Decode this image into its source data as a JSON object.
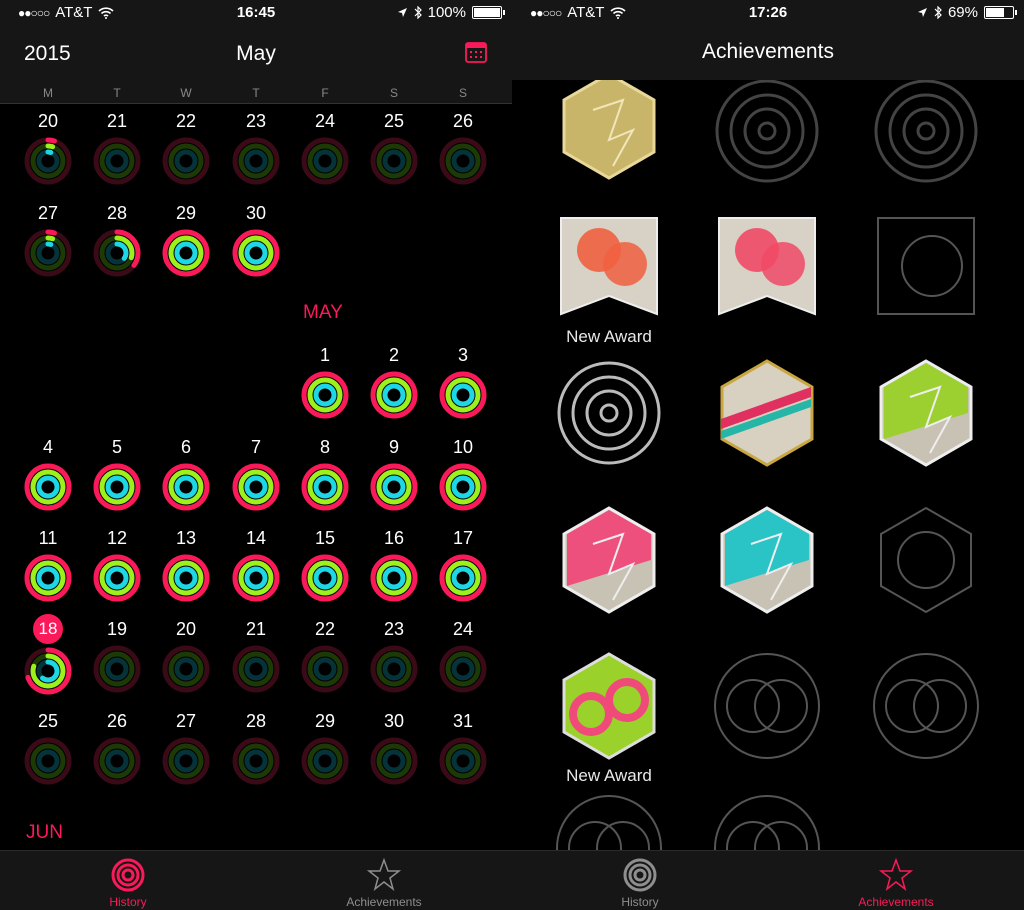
{
  "left": {
    "status": {
      "carrier_dots": "●●○○○",
      "carrier": "AT&T",
      "time": "16:45",
      "battery": "100%",
      "battery_level": 1.0
    },
    "nav": {
      "year": "2015",
      "month": "May"
    },
    "weekdays": [
      "M",
      "T",
      "W",
      "T",
      "F",
      "S",
      "S"
    ],
    "april_week1": [
      "20",
      "21",
      "22",
      "23",
      "24",
      "25",
      "26"
    ],
    "april_week2": [
      "27",
      "28",
      "29",
      "30"
    ],
    "may_label": "MAY",
    "may_week1": [
      "1",
      "2",
      "3"
    ],
    "may_week2": [
      "4",
      "5",
      "6",
      "7",
      "8",
      "9",
      "10"
    ],
    "may_week3": [
      "11",
      "12",
      "13",
      "14",
      "15",
      "16",
      "17"
    ],
    "may_week4": [
      "18",
      "19",
      "20",
      "21",
      "22",
      "23",
      "24"
    ],
    "may_week5": [
      "25",
      "26",
      "27",
      "28",
      "29",
      "30",
      "31"
    ],
    "jun_label": "JUN",
    "tabs": {
      "history": "History",
      "achievements": "Achievements"
    }
  },
  "right": {
    "status": {
      "carrier_dots": "●●○○○",
      "carrier": "AT&T",
      "time": "17:26",
      "battery": "69%",
      "battery_level": 0.69
    },
    "nav": {
      "title": "Achievements"
    },
    "labels": {
      "award1": "New Award",
      "award2": "New Award"
    },
    "tabs": {
      "history": "History",
      "achievements": "Achievements"
    }
  },
  "colors": {
    "accent": "#fa1a5a",
    "move": "#fa1a5a",
    "exercise": "#9cf01c",
    "stand": "#1ed7e6",
    "bg": "#000000",
    "bar": "#161616"
  }
}
